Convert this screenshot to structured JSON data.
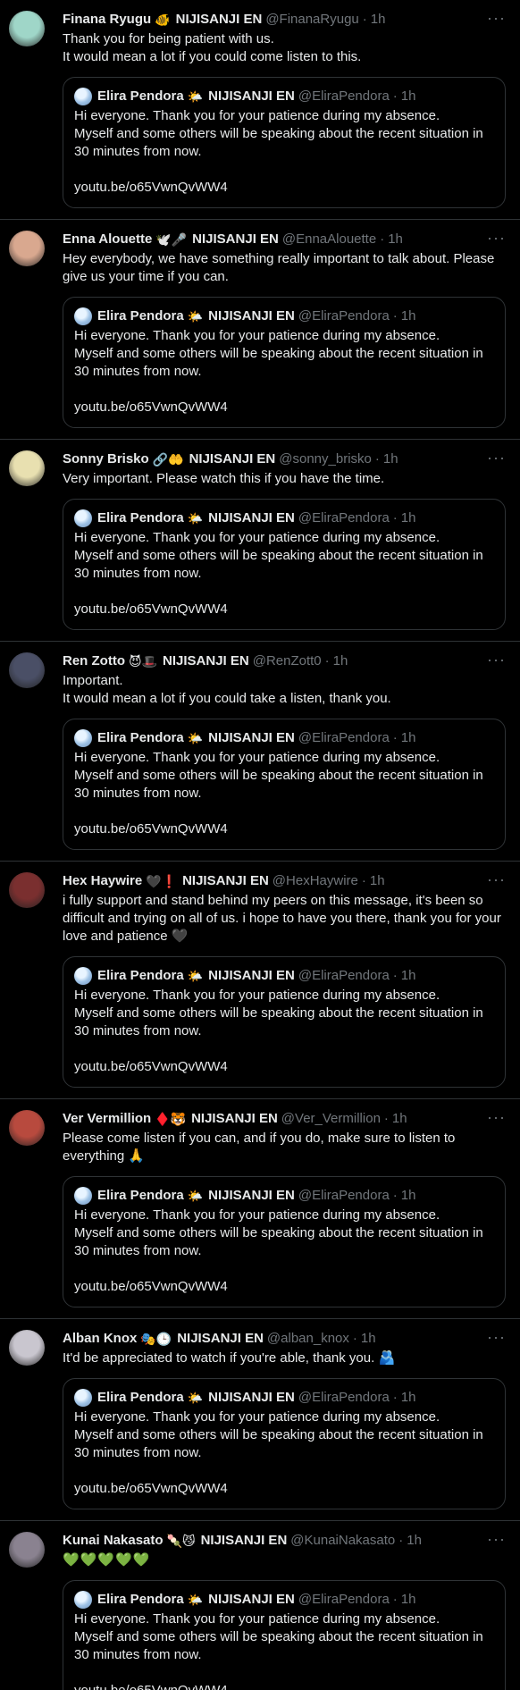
{
  "colors": {
    "background": "#000000",
    "text": "#e7e9ea",
    "muted": "#71767b",
    "border": "#2f3336"
  },
  "quote": {
    "name": "Elira Pendora",
    "emoji": "🌤️",
    "badge": "NIJISANJI EN",
    "handle": "@EliraPendora",
    "time": "1h",
    "text": "Hi everyone. Thank you for your patience during my absence.\nMyself and some others will be speaking about the recent situation in 30 minutes from now.",
    "link": "youtu.be/o65VwnQvWW4"
  },
  "tweets": [
    {
      "name": "Finana Ryugu",
      "emoji": "🐠",
      "badge": "NIJISANJI EN",
      "handle": "@FinanaRyugu",
      "time": "1h",
      "text": "Thank you for being patient with us.\nIt would mean a lot if you could come listen to this.",
      "avatar_color": "#9fd6c8"
    },
    {
      "name": "Enna Alouette",
      "emoji": "🕊️🎤",
      "badge": "NIJISANJI EN",
      "handle": "@EnnaAlouette",
      "time": "1h",
      "text": "Hey everybody, we have something really important to talk about. Please give us your time if you can.",
      "avatar_color": "#d9a88f"
    },
    {
      "name": "Sonny Brisko",
      "emoji": "🔗🤲",
      "badge": "NIJISANJI EN",
      "handle": "@sonny_brisko",
      "time": "1h",
      "text": "Very important. Please watch this if you have the time.",
      "avatar_color": "#e8e0b0"
    },
    {
      "name": "Ren Zotto",
      "emoji": "😈🎩",
      "badge": "NIJISANJI EN",
      "handle": "@RenZott0",
      "time": "1h",
      "text": "Important.\nIt would mean a lot if you could take a listen, thank you.",
      "avatar_color": "#4a4f66"
    },
    {
      "name": "Hex Haywire",
      "emoji": "🖤❗",
      "badge": "NIJISANJI EN",
      "handle": "@HexHaywire",
      "time": "1h",
      "text": "i fully support and stand behind my peers on this message, it's been so difficult and trying on all of us. i hope to have you there, thank you for your love and patience 🖤",
      "avatar_color": "#7a2f2f"
    },
    {
      "name": "Ver Vermillion",
      "emoji": "♦️🐯",
      "badge": "NIJISANJI EN",
      "handle": "@Ver_Vermillion",
      "time": "1h",
      "text": "Please come listen if you can, and if you do, make sure to listen to everything 🙏",
      "avatar_color": "#b84a3e"
    },
    {
      "name": "Alban Knox",
      "emoji": "🎭🕒",
      "badge": "NIJISANJI EN",
      "handle": "@alban_knox",
      "time": "1h",
      "text": "It'd be appreciated to watch if you're able, thank you. 🫂",
      "avatar_color": "#c9c6cf"
    },
    {
      "name": "Kunai Nakasato",
      "emoji": "🍡😼",
      "badge": "NIJISANJI EN",
      "handle": "@KunaiNakasato",
      "time": "1h",
      "text": "💚💚💚💚💚",
      "avatar_color": "#8a8290"
    }
  ]
}
